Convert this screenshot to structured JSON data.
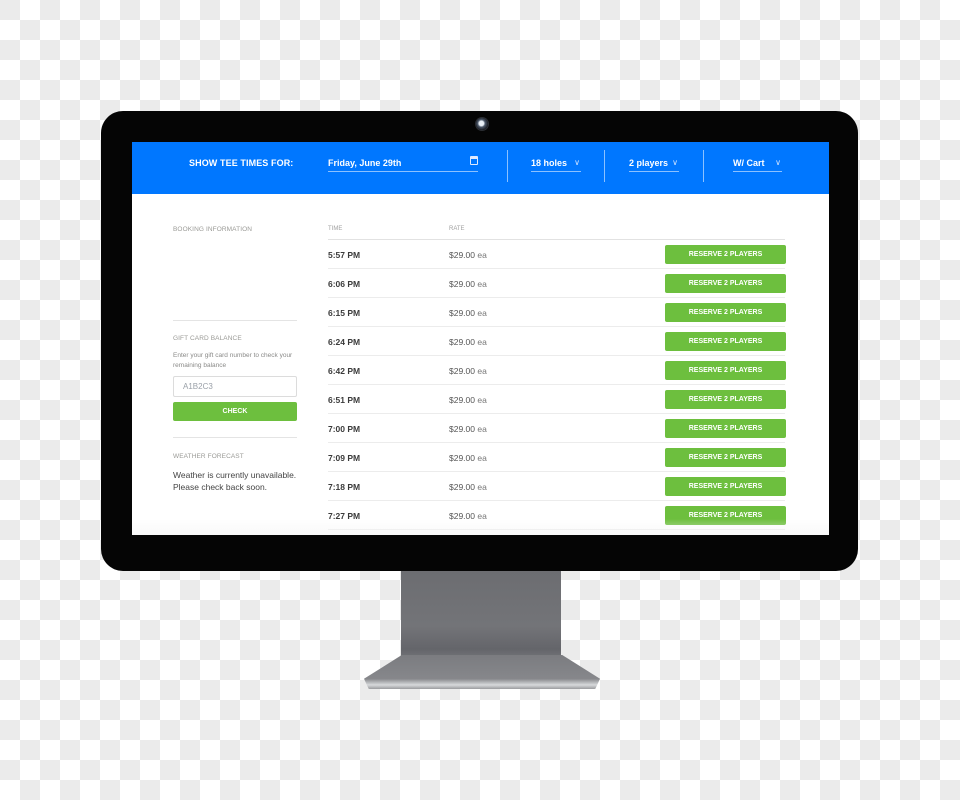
{
  "header": {
    "label": "SHOW TEE TIMES FOR:",
    "date": "Friday, June 29th",
    "date_icon": "calendar-icon",
    "holes": "18 holes",
    "players": "2 players",
    "cart": "W/ Cart",
    "chevron": "∨"
  },
  "sidebar": {
    "booking_title": "BOOKING INFORMATION",
    "gift_title": "GIFT CARD BALANCE",
    "gift_help": "Enter your gift card number to check your remaining balance",
    "gift_input_value": "A1B2C3",
    "check_label": "CHECK",
    "weather_title": "WEATHER FORECAST",
    "weather_line1": "Weather is currently unavailable.",
    "weather_line2": "Please check back soon."
  },
  "table": {
    "col_time": "TIME",
    "col_rate": "RATE",
    "rows": [
      {
        "time": "5:57 PM",
        "rate": "$29.00",
        "unit": "ea",
        "action": "RESERVE 2 PLAYERS"
      },
      {
        "time": "6:06 PM",
        "rate": "$29.00",
        "unit": "ea",
        "action": "RESERVE 2 PLAYERS"
      },
      {
        "time": "6:15 PM",
        "rate": "$29.00",
        "unit": "ea",
        "action": "RESERVE 2 PLAYERS"
      },
      {
        "time": "6:24 PM",
        "rate": "$29.00",
        "unit": "ea",
        "action": "RESERVE 2 PLAYERS"
      },
      {
        "time": "6:42 PM",
        "rate": "$29.00",
        "unit": "ea",
        "action": "RESERVE 2 PLAYERS"
      },
      {
        "time": "6:51 PM",
        "rate": "$29.00",
        "unit": "ea",
        "action": "RESERVE 2 PLAYERS"
      },
      {
        "time": "7:00 PM",
        "rate": "$29.00",
        "unit": "ea",
        "action": "RESERVE 2 PLAYERS"
      },
      {
        "time": "7:09 PM",
        "rate": "$29.00",
        "unit": "ea",
        "action": "RESERVE 2 PLAYERS"
      },
      {
        "time": "7:18 PM",
        "rate": "$29.00",
        "unit": "ea",
        "action": "RESERVE 2 PLAYERS"
      },
      {
        "time": "7:27 PM",
        "rate": "$29.00",
        "unit": "ea",
        "action": "RESERVE 2 PLAYERS"
      }
    ]
  },
  "colors": {
    "header_blue": "#0077ff",
    "button_green": "#6dbf3e",
    "frame": "#050505"
  }
}
